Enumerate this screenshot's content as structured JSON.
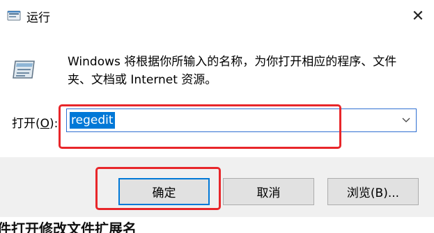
{
  "window": {
    "title": "运行",
    "close_glyph": "✕"
  },
  "description": "Windows 将根据你所输入的名称，为你打开相应的程序、文件夹、文档或 Internet 资源。",
  "open_field": {
    "label_prefix": "打开(",
    "label_accel": "O",
    "label_suffix": "):",
    "value": "regedit",
    "dropdown_glyph": "⌵"
  },
  "buttons": {
    "ok": "确定",
    "cancel": "取消",
    "browse": "浏览(B)..."
  },
  "background_text": "件打开修改文件扩展名",
  "colors": {
    "selection": "#0078d7",
    "annotation": "#e8262a",
    "footer": "#f0f0f0"
  }
}
